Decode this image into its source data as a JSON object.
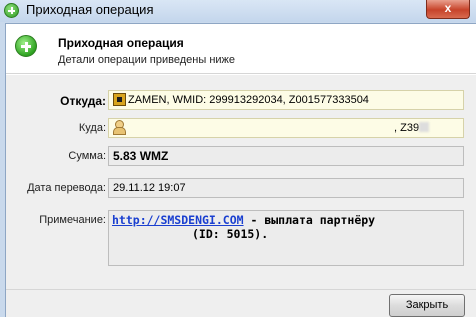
{
  "window": {
    "title": "Приходная операция",
    "close_glyph": "x"
  },
  "header": {
    "title": "Приходная операция",
    "subtitle": "Детали операции приведены ниже"
  },
  "fields": {
    "from": {
      "label": "Откуда:",
      "value": "ZAMEN, WMID: 299913292034, Z001577333504"
    },
    "to": {
      "label": "Куда:",
      "value_suffix": ", Z39"
    },
    "amount": {
      "label": "Сумма:",
      "value": "5.83 WMZ"
    },
    "date": {
      "label": "Дата перевода:",
      "value": "29.11.12 19:07"
    },
    "note": {
      "label": "Примечание:",
      "link": "http://SMSDENGI.COM",
      "text1": " - выплата партнёру",
      "text2": "(ID: 5015)."
    }
  },
  "footer": {
    "close_label": "Закрыть"
  },
  "icons": {
    "title": "add-circle-icon",
    "header": "add-circle-icon",
    "from": "webmoney-passport-icon",
    "to": "person-icon"
  }
}
